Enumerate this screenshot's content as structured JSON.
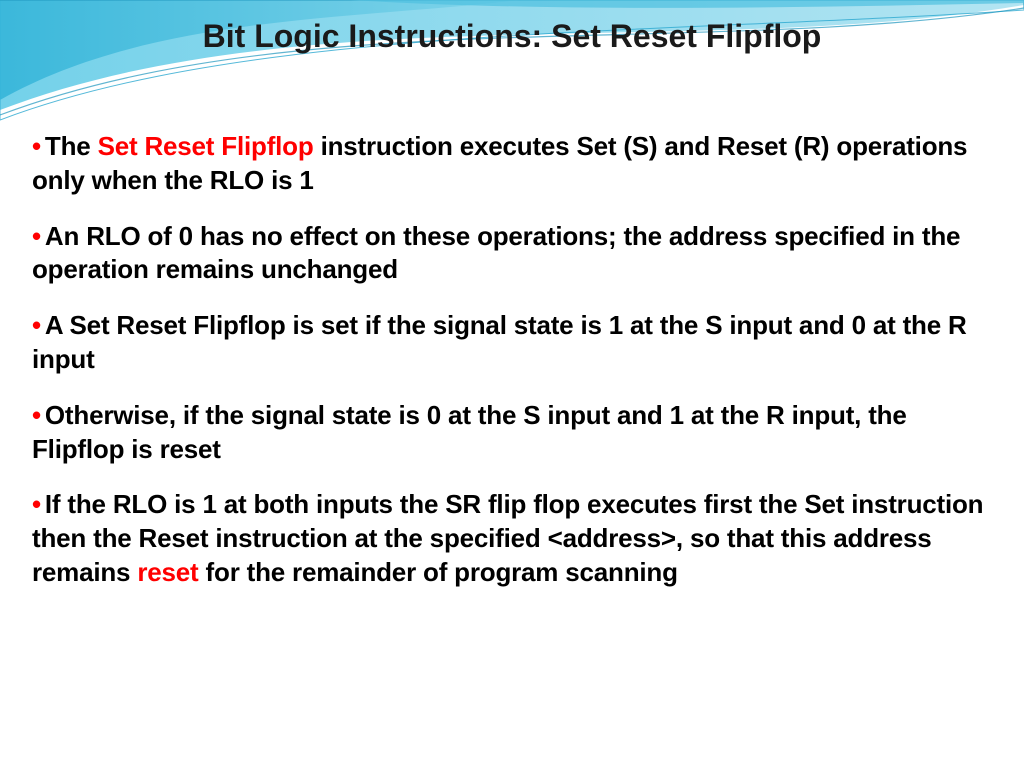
{
  "title": "Bit Logic Instructions: Set Reset Flipflop",
  "bullets": {
    "b0": {
      "pre": "The ",
      "hl": "Set Reset Flipflop",
      "post": " instruction executes Set (S) and Reset (R) operations only when the RLO is 1"
    },
    "b1": {
      "text": "An RLO of 0 has no effect on these operations; the address specified in the operation remains unchanged"
    },
    "b2": {
      "text": "A Set Reset Flipflop is set if the signal state is 1 at the S input and 0 at the R input"
    },
    "b3": {
      "text": "Otherwise, if the signal state is 0 at the S input and 1 at the R input, the Flipflop is reset"
    },
    "b4": {
      "pre": "If the RLO is 1 at both inputs the SR flip flop executes first the Set instruction then the Reset instruction at the specified <address>, so that this address remains ",
      "hl": "reset",
      "post": " for the remainder of program scanning"
    }
  },
  "dot": "•"
}
